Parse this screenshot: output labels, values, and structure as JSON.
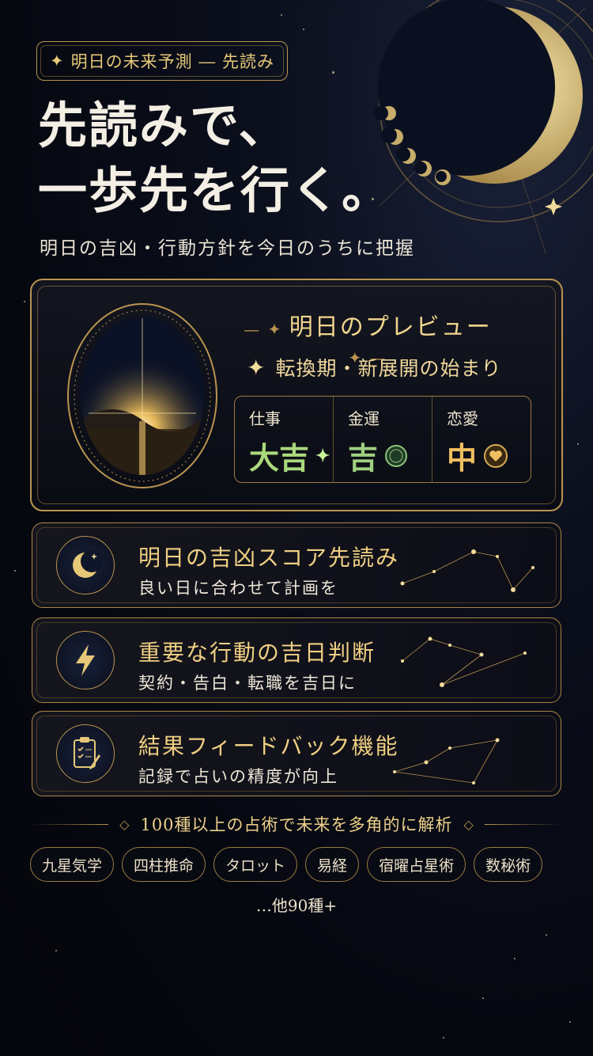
{
  "tag": {
    "label": "明日の未来予測 ― 先読み"
  },
  "headline": {
    "line1": "先読みで、",
    "line2": "一歩先を行く。"
  },
  "subheadline": "明日の吉凶・行動方針を今日のうちに把握",
  "preview": {
    "title": "明日のプレビュー",
    "phase": "転換期・新展開の始まり",
    "fortunes": [
      {
        "label": "仕事",
        "value": "大吉",
        "color": "#a9d97b",
        "icon": "sparkle-icon"
      },
      {
        "label": "金運",
        "value": "吉",
        "color": "#9fd080",
        "icon": "coin-icon"
      },
      {
        "label": "恋愛",
        "value": "中",
        "color": "#f0c060",
        "icon": "heart-icon"
      }
    ]
  },
  "features": [
    {
      "title": "明日の吉凶スコア先読み",
      "desc": "良い日に合わせて計画を",
      "icon": "crescent-moon-icon"
    },
    {
      "title": "重要な行動の吉日判断",
      "desc": "契約・告白・転職を吉日に",
      "icon": "lightning-icon"
    },
    {
      "title": "結果フィードバック機能",
      "desc": "記録で占いの精度が向上",
      "icon": "clipboard-icon"
    }
  ],
  "divination": {
    "heading": "100種以上の占術で未来を多角的に解析",
    "chips": [
      "九星気学",
      "四柱推命",
      "タロット",
      "易経",
      "宿曜占星術",
      "数秘術"
    ],
    "more": "…他90種+"
  },
  "colors": {
    "gold": "#b9944f",
    "background": "#070912"
  }
}
